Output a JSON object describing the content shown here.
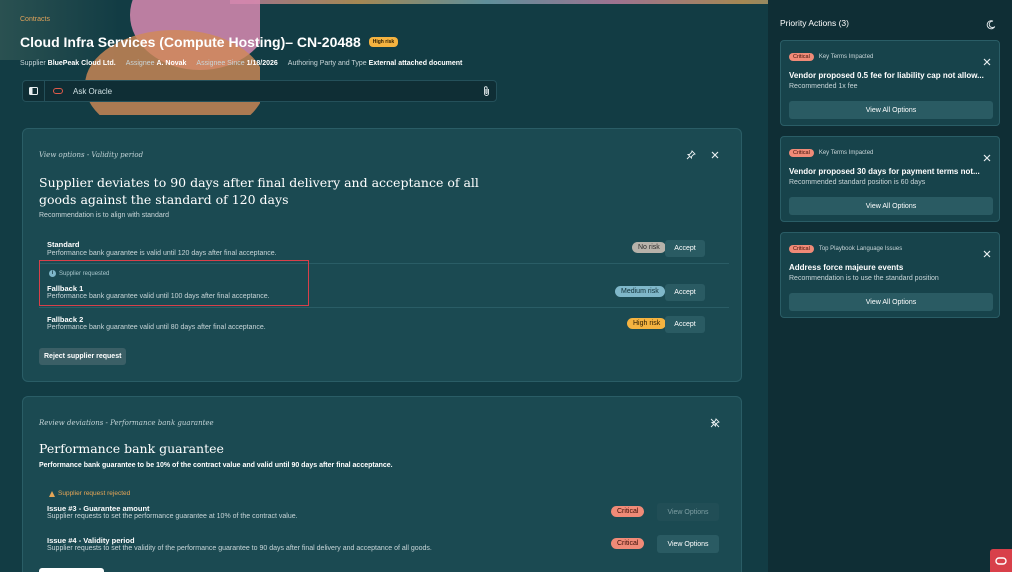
{
  "header": {
    "breadcrumb": "Contracts",
    "title": "Cloud Infra Services (Compute Hosting)– CN-20488",
    "risk_badge": "High risk",
    "supplier_label": "Supplier",
    "supplier_value": "BluePeak Cloud Ltd.",
    "assignee_label": "Assignee",
    "assignee_value": "A. Novak",
    "assignee_since_label": "Assignee Since",
    "assignee_since_value": "1/18/2026",
    "authoring_label": "Authoring Party and Type",
    "authoring_value": "External attached document"
  },
  "ask_bar": {
    "placeholder": "Ask Oracle"
  },
  "card1": {
    "subtitle": "View options - Validity period",
    "heading": "Supplier deviates to 90 days after final delivery and acceptance of all goods against the standard of 120 days",
    "note": "Recommendation is to align with standard",
    "supplier_requested": "Supplier requested",
    "options": [
      {
        "name": "Standard",
        "desc": "Performance bank guarantee is valid until 120 days after final acceptance.",
        "risk": "No risk",
        "action": "Accept"
      },
      {
        "name": "Fallback 1",
        "desc": "Performance bank guarantee valid until 100 days after final acceptance.",
        "risk": "Medium risk",
        "action": "Accept"
      },
      {
        "name": "Fallback 2",
        "desc": "Performance bank guarantee valid until 80 days after final acceptance.",
        "risk": "High risk",
        "action": "Accept"
      }
    ],
    "reject_label": "Reject supplier request"
  },
  "card2": {
    "subtitle": "Review deviations - Performance bank guarantee",
    "heading": "Performance bank guarantee",
    "bold_text": "Performance bank guarantee to be 10% of the contract value and valid until 90 days after final acceptance.",
    "rejected_note": "Supplier request rejected",
    "issues": [
      {
        "name": "Issue #3 - Guarantee amount",
        "desc": "Supplier requests to set the performance guarantee at 10% of the contract value.",
        "severity": "Critical",
        "action": "View Options"
      },
      {
        "name": "Issue #4 - Validity period",
        "desc": "Supplier requests to set the validity of the performance guarantee to 90 days after final delivery and acceptance of all goods.",
        "severity": "Critical",
        "action": "View Options"
      }
    ]
  },
  "priority": {
    "title": "Priority Actions (3)",
    "items": [
      {
        "tag": "Critical",
        "category": "Key Terms Impacted",
        "headline": "Vendor proposed 0.5 fee for liability cap not allow...",
        "rec": "Recommended 1x fee",
        "button": "View All Options"
      },
      {
        "tag": "Critical",
        "category": "Key Terms Impacted",
        "headline": "Vendor proposed 30 days for payment terms not...",
        "rec": "Recommended standard position is 60 days",
        "button": "View All Options"
      },
      {
        "tag": "Critical",
        "category": "Top Playbook Language Issues",
        "headline": "Address force majeure events",
        "rec": "Recommendation is to use the standard position",
        "button": "View All Options"
      }
    ]
  },
  "colors": {
    "background": "#123c44",
    "card": "#1b4a52",
    "panel": "#0f2e35",
    "critical": "#f08a77",
    "high": "#f5b340",
    "medium": "#7fb7c9",
    "highlight": "#d8404a"
  }
}
